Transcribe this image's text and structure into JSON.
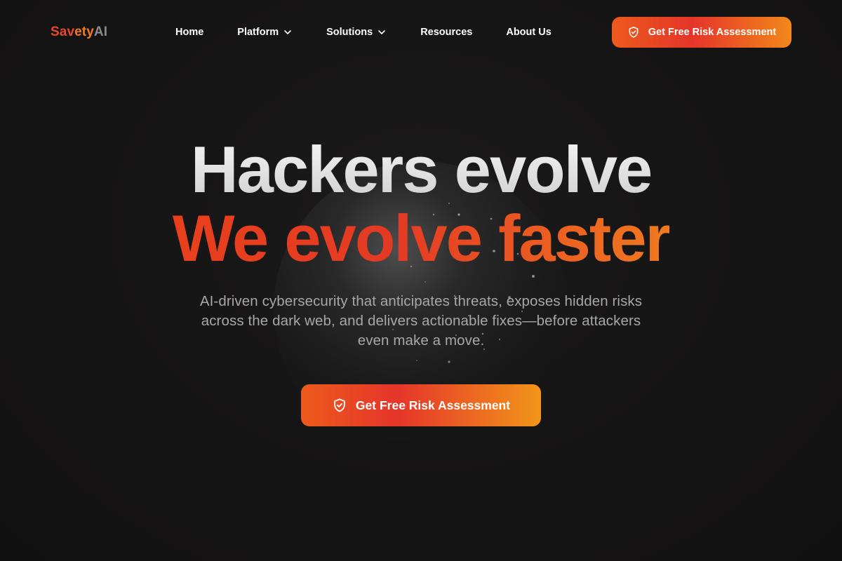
{
  "brand": {
    "part1": "Sav",
    "part2": "ety",
    "part3": "AI",
    "colors": {
      "primary": "#e8472a",
      "secondary": "#f07a20",
      "muted": "#8a8a90"
    }
  },
  "nav": {
    "items": [
      {
        "label": "Home",
        "has_dropdown": false
      },
      {
        "label": "Platform",
        "has_dropdown": true
      },
      {
        "label": "Solutions",
        "has_dropdown": true
      },
      {
        "label": "Resources",
        "has_dropdown": false
      },
      {
        "label": "About Us",
        "has_dropdown": false
      }
    ],
    "cta_label": "Get Free Risk Assessment"
  },
  "hero": {
    "headline_line1": "Hackers evolve",
    "headline_line2": "We evolve faster",
    "subtitle": "AI-driven cybersecurity that anticipates threats, exposes hidden risks across the dark web, and delivers actionable fixes—before attackers even make a move.",
    "cta_label": "Get Free Risk Assessment"
  },
  "theme": {
    "background": "#141313",
    "accent_start": "#ec5a1c",
    "accent_mid": "#e5352a",
    "accent_end": "#f2881a",
    "text_primary": "#ffffff",
    "text_muted": "#a7a7a7"
  },
  "icons": {
    "cta_icon": "shield-check-icon",
    "dropdown_icon": "chevron-down-icon"
  }
}
